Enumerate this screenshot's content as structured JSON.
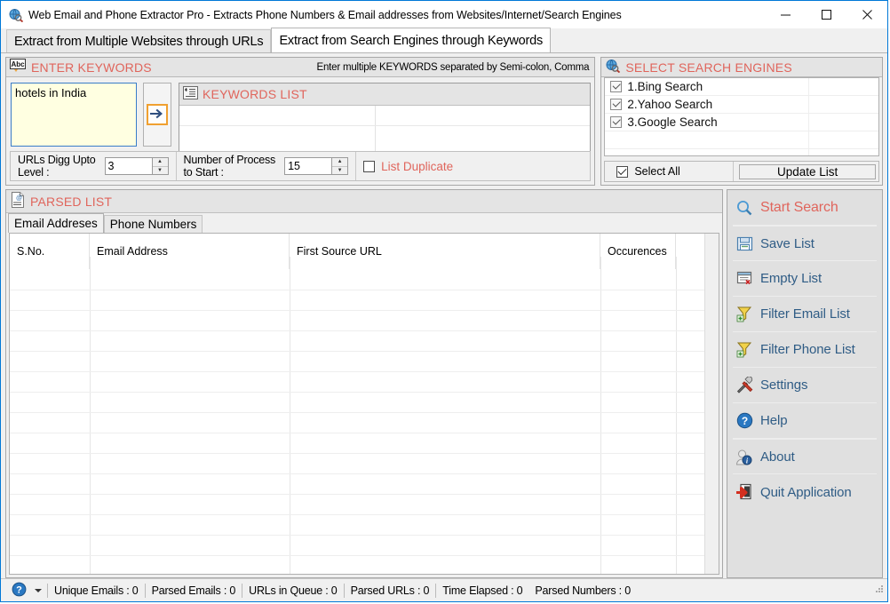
{
  "window": {
    "title": "Web Email and Phone Extractor Pro - Extracts Phone Numbers & Email addresses from Websites/Internet/Search Engines",
    "icon": "globe-magnifier-icon",
    "minimize_label": "─",
    "maximize_label": "□",
    "close_label": "✕"
  },
  "tabs": [
    {
      "label": "Extract from Multiple Websites through URLs",
      "active": false
    },
    {
      "label": "Extract from Search Engines through Keywords",
      "active": true
    }
  ],
  "keywords_panel": {
    "icon": "abc-spellcheck-icon",
    "title": "ENTER KEYWORDS",
    "hint": "Enter multiple KEYWORDS separated by Semi-colon, Comma",
    "input_value": "hotels in India",
    "input_placeholder": "",
    "add_button_icon": "arrow-right-icon",
    "list": {
      "icon": "list-icon",
      "title": "KEYWORDS LIST",
      "rows": []
    }
  },
  "options": {
    "digg_label": "URLs Digg Upto\nLevel :",
    "digg_label_line1": "URLs Digg Upto",
    "digg_label_line2": "Level :",
    "digg_value": "3",
    "process_label_line1": "Number of Process",
    "process_label_line2": "to Start :",
    "process_value": "15",
    "list_duplicate_label": "List Duplicate",
    "list_duplicate_checked": false
  },
  "search_engines": {
    "icon": "globe-magnifier-icon",
    "title": "SELECT SEARCH ENGINES",
    "items": [
      {
        "label": "1.Bing Search",
        "checked": true
      },
      {
        "label": "2.Yahoo Search",
        "checked": true
      },
      {
        "label": "3.Google Search",
        "checked": true
      }
    ],
    "select_all_label": "Select All",
    "select_all_checked": true,
    "update_button_label": "Update List"
  },
  "parsed_list": {
    "icon": "document-at-icon",
    "title": "PARSED LIST",
    "tabs": [
      {
        "label": "Email Addreses",
        "active": true
      },
      {
        "label": "Phone Numbers",
        "active": false
      }
    ],
    "columns": [
      "S.No.",
      "Email Address",
      "First Source URL",
      "Occurences"
    ],
    "rows": []
  },
  "sidebar": {
    "items": [
      {
        "label": "Start Search",
        "icon": "magnifier-icon",
        "primary": true
      },
      {
        "label": "Save List",
        "icon": "floppy-disk-icon",
        "primary": false
      },
      {
        "label": "Empty List",
        "icon": "empty-list-icon",
        "primary": false
      },
      {
        "label": "Filter Email List",
        "icon": "funnel-add-icon",
        "primary": false
      },
      {
        "label": "Filter Phone List",
        "icon": "funnel-add-icon",
        "primary": false
      },
      {
        "label": "Settings",
        "icon": "hammer-wrench-icon",
        "primary": false
      },
      {
        "label": "Help",
        "icon": "question-circle-icon",
        "primary": false
      },
      {
        "label": "About",
        "icon": "person-info-icon",
        "primary": false
      },
      {
        "label": "Quit Application",
        "icon": "exit-door-icon",
        "primary": false
      }
    ]
  },
  "statusbar": {
    "help_icon": "question-circle-icon",
    "cells": [
      "Unique Emails :  0",
      "Parsed Emails :  0",
      "URLs in Queue :  0",
      "Parsed URLs :  0",
      "Time Elapsed :  0",
      "Parsed Numbers :  0"
    ]
  },
  "colors": {
    "accent_red": "#e0655c",
    "link_blue": "#2f5c85",
    "window_border": "#0078d7",
    "input_yellow": "#ffffe1"
  }
}
